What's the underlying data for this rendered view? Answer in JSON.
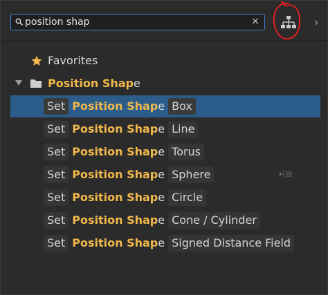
{
  "search": {
    "value": "position shap",
    "clear_symbol": "×"
  },
  "header": {
    "hierarchy_icon": "hierarchy-icon",
    "next_symbol": "›",
    "annotation_color": "#e0201f"
  },
  "tree": {
    "favorites_label": "Favorites",
    "folder": {
      "highlight": "Position Shap",
      "suffix": "e"
    }
  },
  "items": [
    {
      "prefix": "Set",
      "highlight": "Position Shap",
      "suffix": "e",
      "tag": "Box",
      "selected": true
    },
    {
      "prefix": "Set",
      "highlight": "Position Shap",
      "suffix": "e",
      "tag": "Line"
    },
    {
      "prefix": "Set",
      "highlight": "Position Shap",
      "suffix": "e",
      "tag": "Torus"
    },
    {
      "prefix": "Set",
      "highlight": "Position Shap",
      "suffix": "e",
      "tag": "Sphere"
    },
    {
      "prefix": "Set",
      "highlight": "Position Shap",
      "suffix": "e",
      "tag": "Circle"
    },
    {
      "prefix": "Set",
      "highlight": "Position Shap",
      "suffix": "e",
      "tag": "Cone / Cylinder"
    },
    {
      "prefix": "Set",
      "highlight": "Position Shap",
      "suffix": "e",
      "tag": "Signed Distance Field"
    }
  ],
  "colors": {
    "accent": "#3d82d9",
    "selection": "#2c5d8a",
    "highlight_text": "#f2b84b",
    "background": "#2b2b2b"
  }
}
